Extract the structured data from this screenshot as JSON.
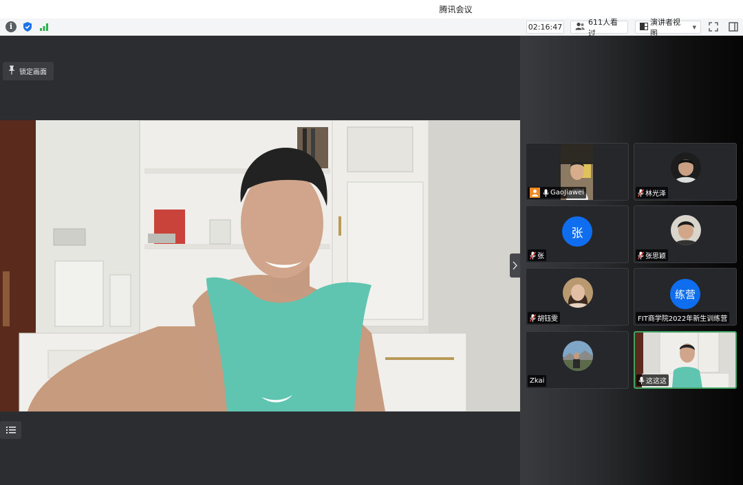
{
  "app": {
    "title": "腾讯会议"
  },
  "toolbar": {
    "timer": "02:16:47",
    "viewers": "611人看过",
    "view_mode": "演讲者视图"
  },
  "main": {
    "lock_button": "锁定画面"
  },
  "participants": [
    {
      "name": "GaoJiawei",
      "muted": false,
      "has_video": true
    },
    {
      "name": "林光泽",
      "muted": true,
      "has_video": false
    },
    {
      "name": "张",
      "muted": true,
      "avatar_text": "张"
    },
    {
      "name": "张思颖",
      "muted": true,
      "has_video": false
    },
    {
      "name": "胡钰雯",
      "muted": true,
      "has_video": false
    },
    {
      "name": "FIT商学院2022年新生训练营",
      "muted": false,
      "avatar_text": "练营"
    },
    {
      "name": "Zkai",
      "muted": false,
      "has_video": false
    },
    {
      "name": "这这这",
      "muted": false,
      "has_video": true,
      "active_speaker": true
    }
  ],
  "colors": {
    "accent_blue": "#0f6ef0",
    "active_green": "#3fa464",
    "mute_red": "#e5463c"
  }
}
